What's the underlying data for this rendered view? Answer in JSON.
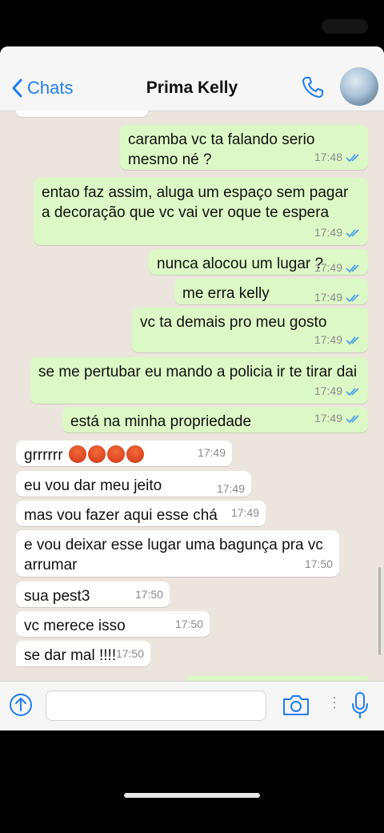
{
  "header": {
    "back_label": "Chats",
    "contact_name": "Prima Kelly"
  },
  "messages": [
    {
      "dir": "out",
      "text": "caramba vc ta falando serio mesmo né ?",
      "time": "17:48",
      "read": true
    },
    {
      "dir": "out",
      "text": "entao faz assim, aluga um espaço sem pagar a decoração que vc vai ver oque te espera",
      "time": "17:49",
      "read": true
    },
    {
      "dir": "out",
      "text": "nunca alocou um lugar ?",
      "time": "17:49",
      "read": true
    },
    {
      "dir": "out",
      "text": "me erra kelly",
      "time": "17:49",
      "read": true
    },
    {
      "dir": "out",
      "text": "vc ta demais pro meu gosto",
      "time": "17:49",
      "read": true
    },
    {
      "dir": "out",
      "text": "se me pertubar eu mando a policia ir te tirar dai",
      "time": "17:49",
      "read": true
    },
    {
      "dir": "out",
      "text": "está na minha propriedade",
      "time": "17:49",
      "read": true
    },
    {
      "dir": "in",
      "text": "grrrrrr",
      "emoji_count": 4,
      "emoji": "angry-face-emoji",
      "time": "17:49"
    },
    {
      "dir": "in",
      "text": "eu vou dar meu jeito",
      "time": "17:49"
    },
    {
      "dir": "in",
      "text": "mas vou fazer aqui esse chá",
      "time": "17:49"
    },
    {
      "dir": "in",
      "text": "e vou deixar esse lugar uma bagunça pra vc arrumar",
      "time": "17:50"
    },
    {
      "dir": "in",
      "text": "sua pest3",
      "time": "17:50"
    },
    {
      "dir": "in",
      "text": "vc merece isso",
      "time": "17:50"
    },
    {
      "dir": "in",
      "text": "se dar mal !!!!",
      "time": "17:50"
    }
  ],
  "colors": {
    "accent": "#1f7df2",
    "outgoing_bubble": "#dcf8c6",
    "incoming_bubble": "#ffffff",
    "chat_background": "#ece5dd",
    "read_ticks": "#4fa3e6"
  },
  "icons": [
    "chevron-left-icon",
    "phone-icon",
    "upload-icon",
    "camera-icon",
    "more-icon",
    "microphone-icon"
  ]
}
